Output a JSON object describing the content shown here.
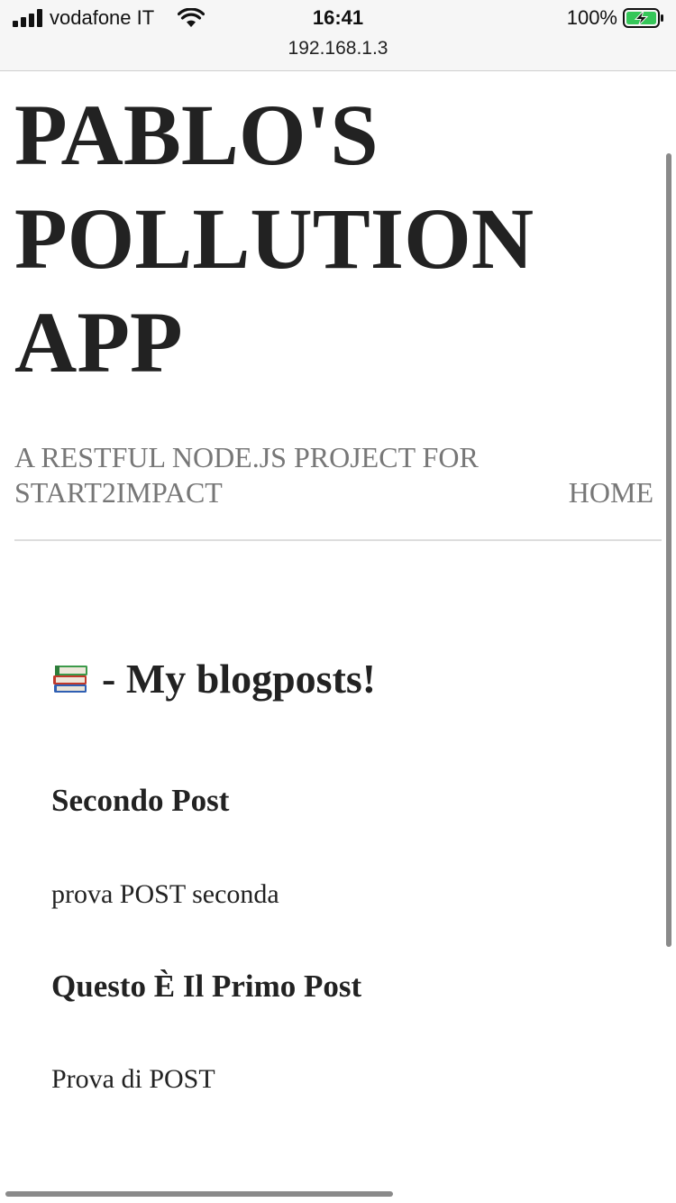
{
  "status_bar": {
    "carrier": "vodafone IT",
    "time": "16:41",
    "url": "192.168.1.3",
    "battery_percent": "100%"
  },
  "header": {
    "title_lines": [
      "PABLO'S",
      "POLLUTION",
      "APP"
    ],
    "tagline_lines": [
      "A RESTFUL NODE.JS PROJECT FOR",
      "START2IMPACT"
    ],
    "nav_home": "HOME"
  },
  "blog": {
    "heading_icon": "books-icon",
    "heading_text": "- My blogposts!",
    "posts": [
      {
        "title": "Secondo Post",
        "body": "prova POST seconda"
      },
      {
        "title": "Questo È Il Primo Post",
        "body": "Prova di POST"
      }
    ]
  },
  "colors": {
    "text": "#222222",
    "muted": "#777777",
    "battery_green": "#35c759"
  }
}
